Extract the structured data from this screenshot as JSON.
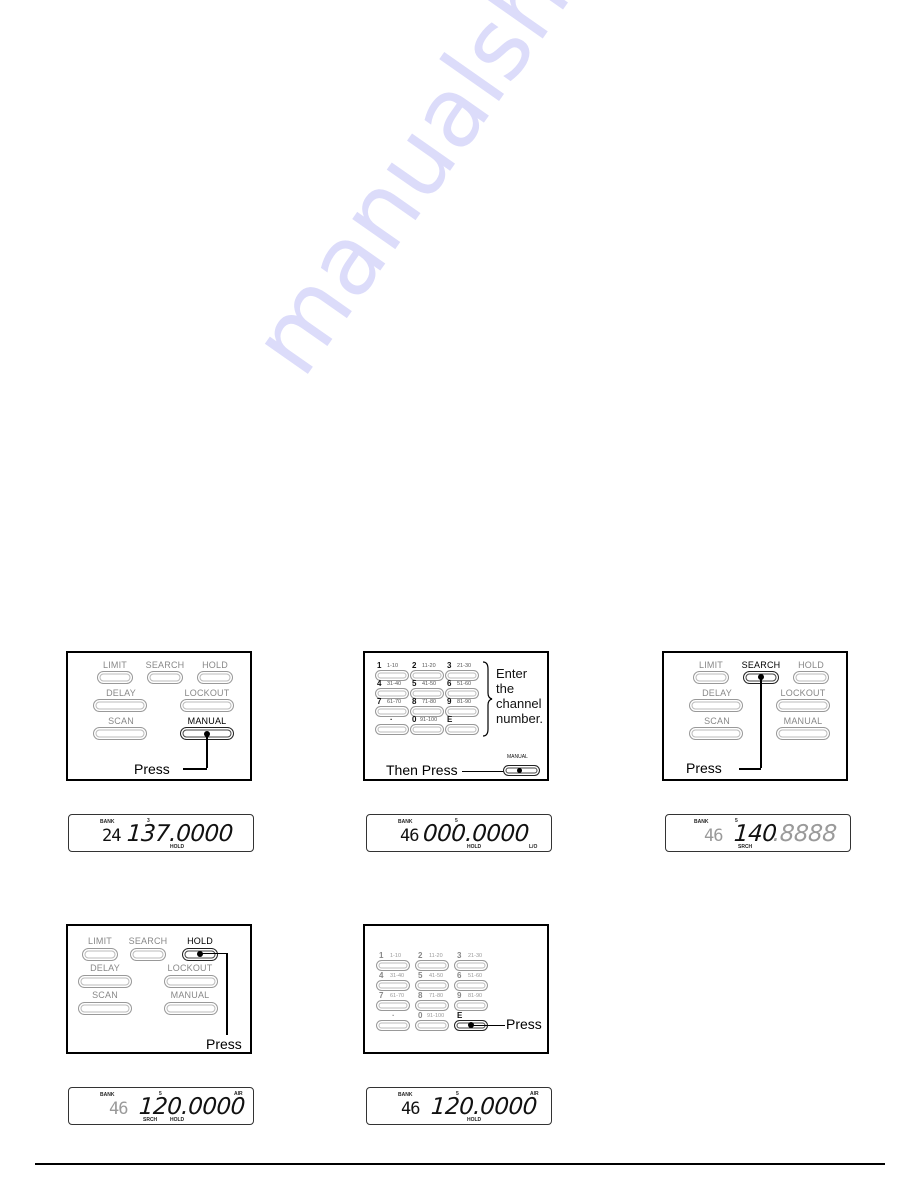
{
  "watermark": "manualshive.com",
  "panels": [
    {
      "id": "step-manual",
      "buttons": {
        "limit": "LIMIT",
        "search": "SEARCH",
        "hold": "HOLD",
        "delay": "DELAY",
        "lockout": "LOCKOUT",
        "scan": "SCAN",
        "manual": "MANUAL"
      },
      "pressed": "MANUAL",
      "callout": "Press",
      "display": {
        "bank_label": "BANK",
        "sub_label": "3",
        "bank": "24",
        "freq": "137.0000",
        "indicators": [
          "HOLD"
        ]
      }
    },
    {
      "id": "step-enter-channel",
      "keys": [
        {
          "num": "1",
          "range": "1-10"
        },
        {
          "num": "2",
          "range": "11-20"
        },
        {
          "num": "3",
          "range": "21-30"
        },
        {
          "num": "4",
          "range": "31-40"
        },
        {
          "num": "5",
          "range": "41-50"
        },
        {
          "num": "6",
          "range": "51-60"
        },
        {
          "num": "7",
          "range": "61-70"
        },
        {
          "num": "8",
          "range": "71-80"
        },
        {
          "num": "9",
          "range": "81-90"
        },
        {
          "num": "·",
          "range": ""
        },
        {
          "num": "0",
          "range": "91-100"
        },
        {
          "num": "E",
          "range": ""
        }
      ],
      "instruction": [
        "Enter",
        "the",
        "channel",
        "number."
      ],
      "then_press": "Then Press",
      "manual_label": "MANUAL",
      "display": {
        "bank_label": "BANK",
        "sub_label": "5",
        "bank": "46",
        "freq": "000.0000",
        "indicators": [
          "HOLD",
          "L/O"
        ]
      }
    },
    {
      "id": "step-search",
      "buttons": {
        "limit": "LIMIT",
        "search": "SEARCH",
        "hold": "HOLD",
        "delay": "DELAY",
        "lockout": "LOCKOUT",
        "scan": "SCAN",
        "manual": "MANUAL"
      },
      "pressed": "SEARCH",
      "callout": "Press",
      "display": {
        "bank_label": "BANK",
        "sub_label": "5",
        "bank": "46",
        "freq_main": "140",
        "freq_rest": ".8888",
        "indicators": [
          "SRCH"
        ]
      }
    },
    {
      "id": "step-hold",
      "buttons": {
        "limit": "LIMIT",
        "search": "SEARCH",
        "hold": "HOLD",
        "delay": "DELAY",
        "lockout": "LOCKOUT",
        "scan": "SCAN",
        "manual": "MANUAL"
      },
      "pressed": "HOLD",
      "callout": "Press",
      "display": {
        "bank_label": "BANK",
        "sub_label": "5",
        "bank": "46",
        "freq": "120.0000",
        "band": "AIR",
        "indicators": [
          "SRCH",
          "HOLD"
        ]
      }
    },
    {
      "id": "step-enter",
      "keys": [
        {
          "num": "1",
          "range": "1-10"
        },
        {
          "num": "2",
          "range": "11-20"
        },
        {
          "num": "3",
          "range": "21-30"
        },
        {
          "num": "4",
          "range": "31-40"
        },
        {
          "num": "5",
          "range": "41-50"
        },
        {
          "num": "6",
          "range": "51-60"
        },
        {
          "num": "7",
          "range": "61-70"
        },
        {
          "num": "8",
          "range": "71-80"
        },
        {
          "num": "9",
          "range": "81-90"
        },
        {
          "num": "·",
          "range": ""
        },
        {
          "num": "0",
          "range": "91-100"
        },
        {
          "num": "E",
          "range": ""
        }
      ],
      "pressed": "E",
      "callout": "Press",
      "display": {
        "bank_label": "BANK",
        "sub_label": "5",
        "bank": "46",
        "freq": "120.0000",
        "band": "AIR",
        "indicators": [
          "HOLD"
        ]
      }
    }
  ]
}
